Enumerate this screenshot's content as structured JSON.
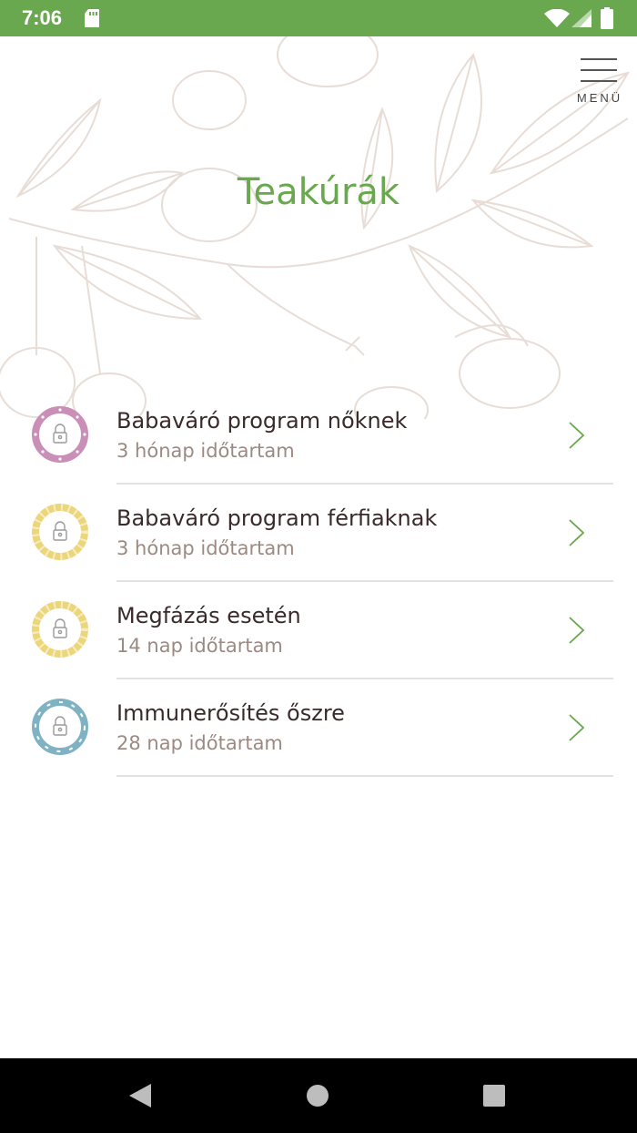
{
  "status_bar": {
    "time": "7:06"
  },
  "menu": {
    "label": "MENÜ"
  },
  "page": {
    "title": "Teakúrák"
  },
  "colors": {
    "accent": "#6aa84f",
    "pink": "#c98fb7",
    "yellow": "#ecd67a",
    "blue": "#7fb3c4"
  },
  "items": [
    {
      "title": "Babaváró program nőknek",
      "subtitle": "3 hónap időtartam",
      "badge_color": "#c98fb7",
      "badge_icon": "lock-icon"
    },
    {
      "title": "Babaváró program férfiaknak",
      "subtitle": "3 hónap időtartam",
      "badge_color": "#ecd67a",
      "badge_icon": "lock-icon"
    },
    {
      "title": "Megfázás esetén",
      "subtitle": "14 nap időtartam",
      "badge_color": "#ecd67a",
      "badge_icon": "lock-icon"
    },
    {
      "title": "Immunerősítés őszre",
      "subtitle": "28 nap időtartam",
      "badge_color": "#7fb3c4",
      "badge_icon": "lock-icon"
    }
  ]
}
